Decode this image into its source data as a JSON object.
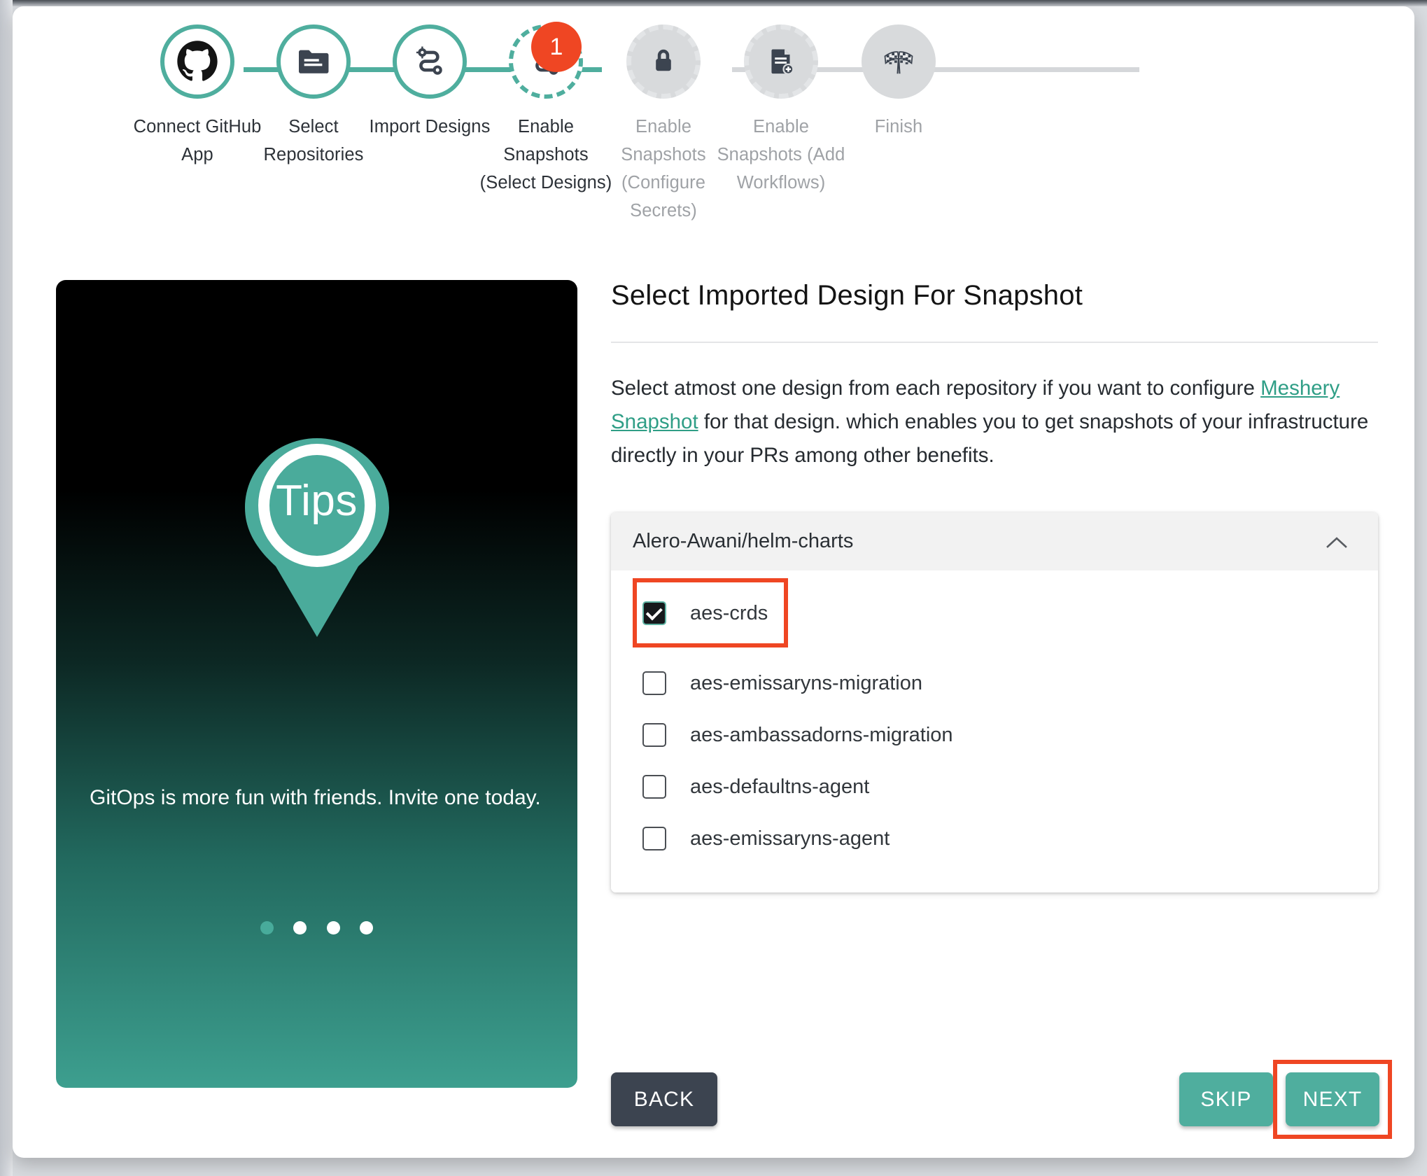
{
  "stepper": {
    "steps": [
      {
        "label": "Connect GitHub\nApp",
        "icon": "github-icon",
        "state": "done"
      },
      {
        "label": "Select\nRepositories",
        "icon": "folder-document-icon",
        "state": "done"
      },
      {
        "label": "Import Designs",
        "icon": "design-path-icon",
        "state": "done"
      },
      {
        "label": "Enable\nSnapshots\n(Select Designs)",
        "icon": "design-path-icon",
        "state": "active",
        "badge": "1"
      },
      {
        "label": "Enable\nSnapshots\n(Configure\nSecrets)",
        "icon": "lock-icon",
        "state": "pending"
      },
      {
        "label": "Enable\nSnapshots (Add\nWorkflows)",
        "icon": "document-add-icon",
        "state": "pending"
      },
      {
        "label": "Finish",
        "icon": "checkered-flags-icon",
        "state": "finish"
      }
    ],
    "colors": {
      "accent": "#4fae9e",
      "inactive": "#d8dadc",
      "badge": "#ef4623"
    }
  },
  "tips": {
    "pin_label": "Tips",
    "message": "GitOps is more fun with friends. Invite one today.",
    "dots_total": 4,
    "dots_active_index": 0
  },
  "main": {
    "title": "Select Imported Design For Snapshot",
    "description_part1": "Select atmost one design from each repository if you want to configure ",
    "description_link": "Meshery Snapshot",
    "description_part2": " for that design. which enables you to get snapshots of your infrastructure directly in your PRs among other benefits.",
    "repository": {
      "name": "Alero-Awani/helm-charts",
      "expanded": true,
      "collapse_icon": "chevron-up-icon",
      "designs": [
        {
          "label": "aes-crds",
          "checked": true,
          "highlighted": true
        },
        {
          "label": "aes-emissaryns-migration",
          "checked": false,
          "highlighted": false
        },
        {
          "label": "aes-ambassadorns-migration",
          "checked": false,
          "highlighted": false
        },
        {
          "label": "aes-defaultns-agent",
          "checked": false,
          "highlighted": false
        },
        {
          "label": "aes-emissaryns-agent",
          "checked": false,
          "highlighted": false
        }
      ]
    }
  },
  "footer": {
    "back_label": "BACK",
    "skip_label": "SKIP",
    "next_label": "NEXT",
    "next_highlighted": true
  }
}
